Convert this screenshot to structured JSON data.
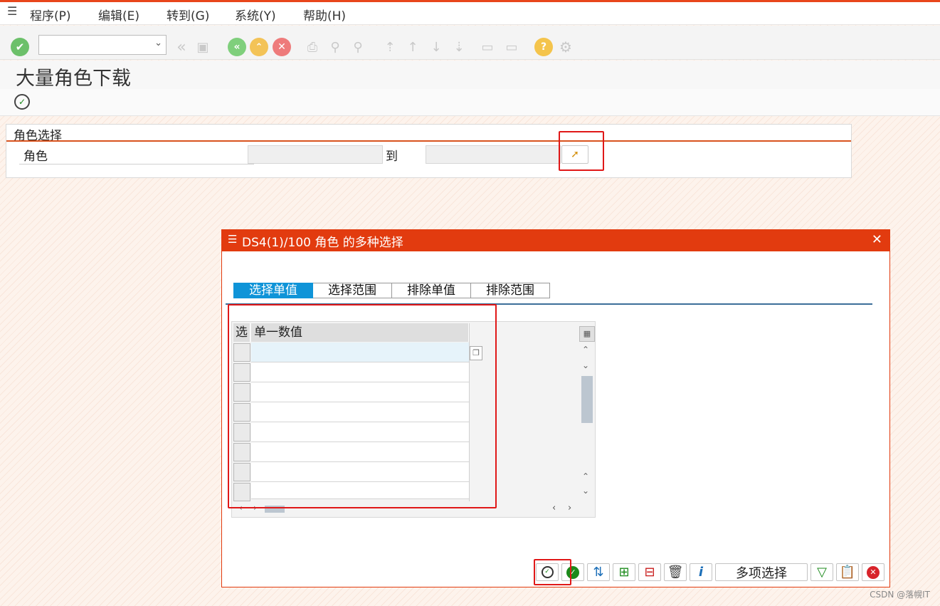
{
  "menu": [
    "程序(P)",
    "编辑(E)",
    "转到(G)",
    "系统(Y)",
    "帮助(H)"
  ],
  "toolbar": {
    "command_value": "",
    "icons": [
      "enter-icon",
      "back-icon",
      "save-icon",
      "back-circle-icon",
      "up-icon",
      "cancel-icon",
      "print-icon",
      "find-icon",
      "find-next-icon",
      "first-page-icon",
      "prev-page-icon",
      "next-page-icon",
      "last-page-icon",
      "new-session-icon",
      "shortcut-icon",
      "help-icon",
      "settings-icon"
    ]
  },
  "page": {
    "title": "大量角色下载"
  },
  "group": {
    "title": "角色选择",
    "field_label": "角色",
    "from_value": "",
    "to_label": "到",
    "to_value": ""
  },
  "dialog": {
    "title": "DS4(1)/100 角色 的多种选择",
    "close": "✕",
    "tabs": [
      "选择单值",
      "选择范围",
      "排除单值",
      "排除范围"
    ],
    "active_tab": 0,
    "table": {
      "columns": [
        "选",
        "单一数值"
      ],
      "rows": [
        "",
        "",
        "",
        "",
        "",
        "",
        "",
        ""
      ]
    },
    "buttons": {
      "multi_select": "多项选择"
    }
  },
  "watermark": "CSDN @落幌IT",
  "colors": {
    "accent": "#e23b0f",
    "tab_active": "#0f94d8",
    "highlight": "#e01818"
  }
}
